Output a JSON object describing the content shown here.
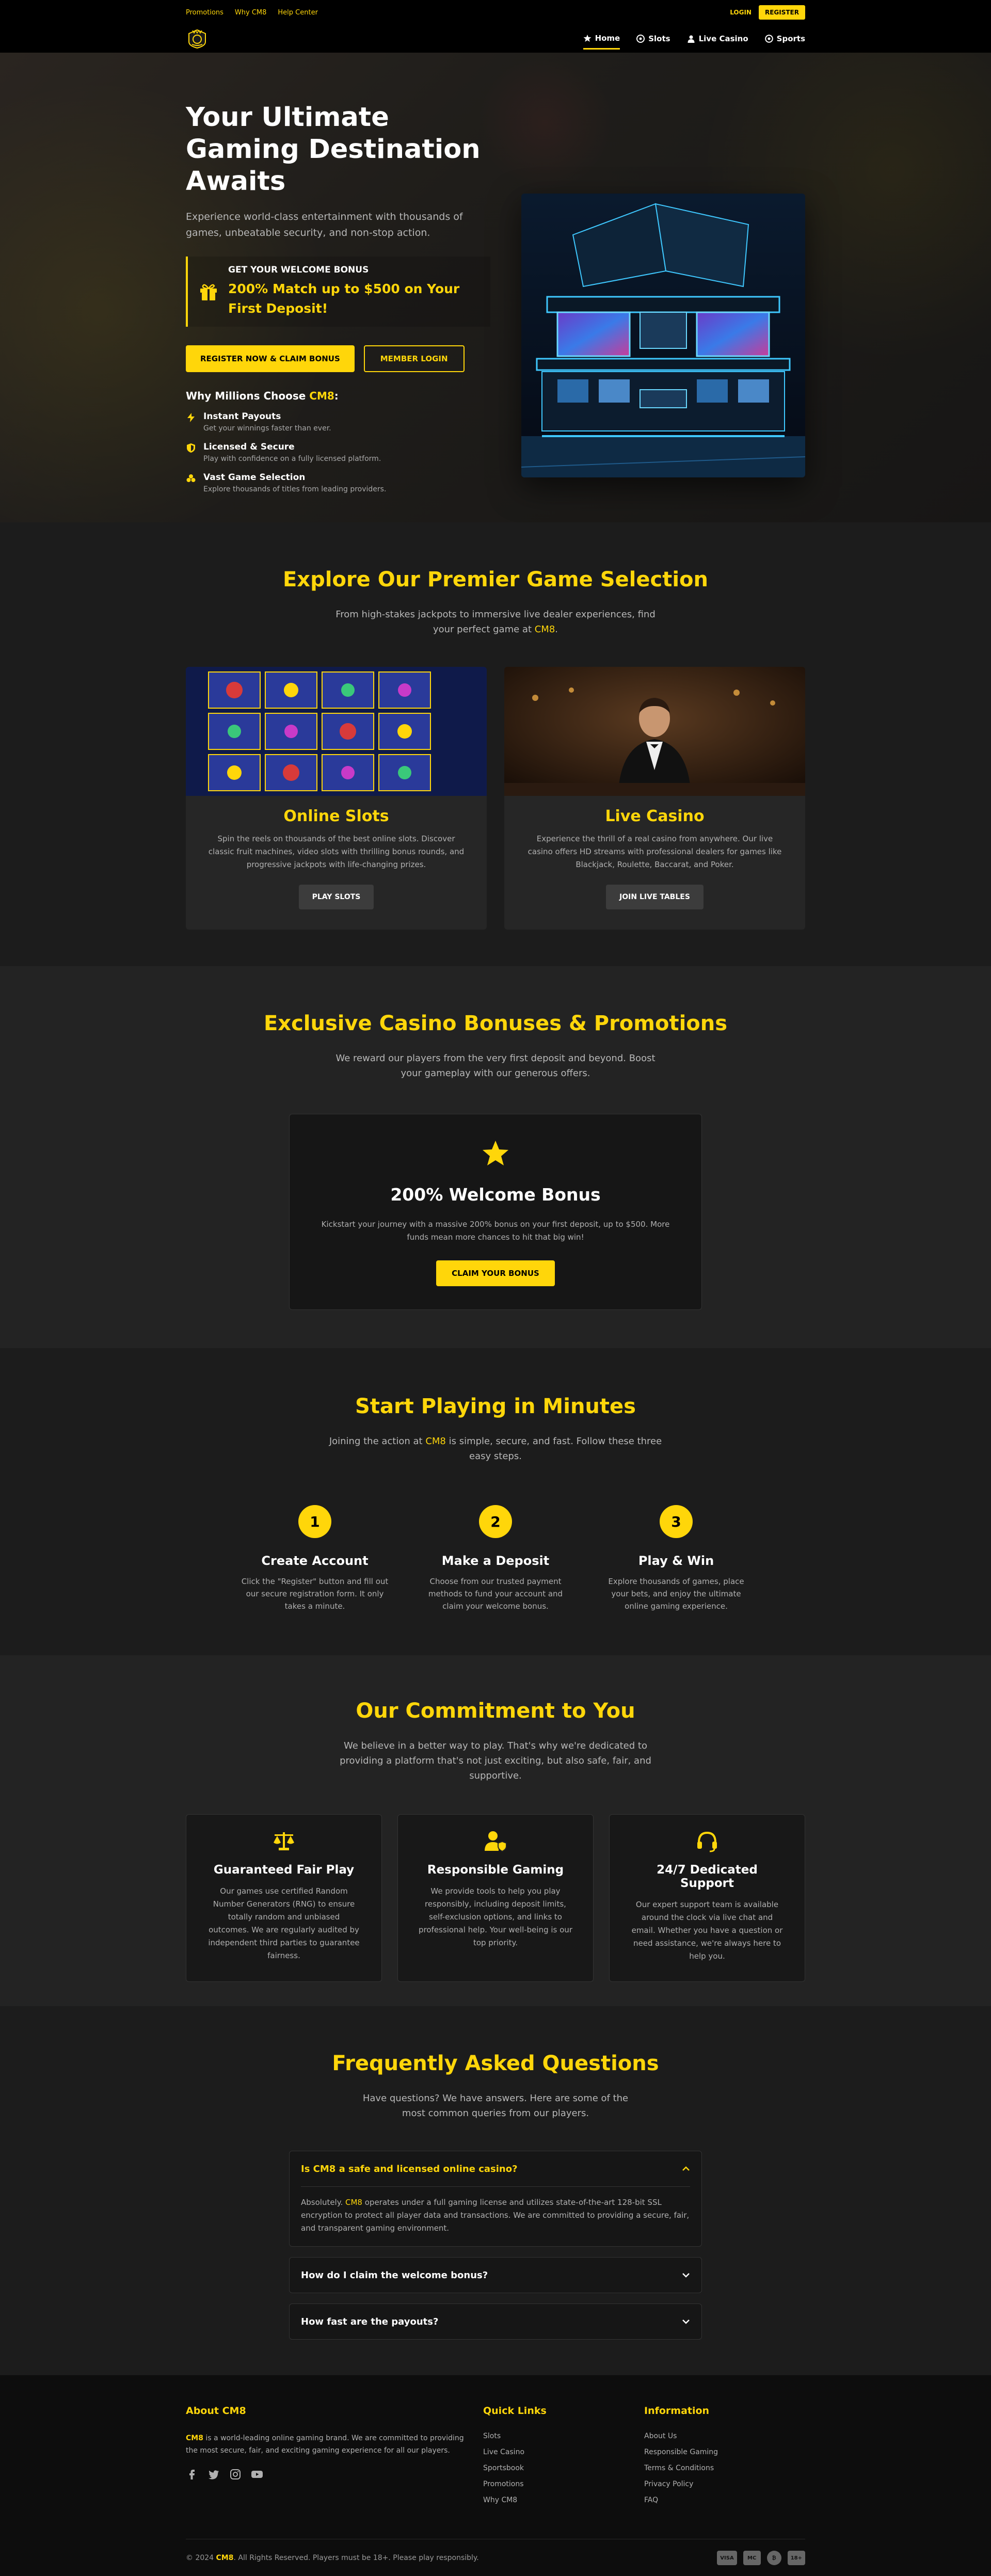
{
  "topbar": {
    "links": [
      "Promotions",
      "Why CM8",
      "Help Center"
    ],
    "login": "LOGIN",
    "register": "REGISTER"
  },
  "nav": {
    "items": [
      {
        "label": "Home",
        "icon": "star-icon",
        "active": true
      },
      {
        "label": "Slots",
        "icon": "dice-icon"
      },
      {
        "label": "Live Casino",
        "icon": "user-icon"
      },
      {
        "label": "Sports",
        "icon": "soccer-ball-icon"
      }
    ]
  },
  "hero": {
    "title": "Your Ultimate Gaming Destination Awaits",
    "subtitle": "Experience world-class entertainment with thousands of games, unbeatable security, and non-stop action.",
    "bonus_title": "GET YOUR WELCOME BONUS",
    "bonus_text": "200% Match up to $500 on Your First Deposit!",
    "primary_btn": "REGISTER NOW & CLAIM BONUS",
    "secondary_btn": "MEMBER LOGIN",
    "why_prefix": "Why Millions Choose ",
    "why_brand": "CM8",
    "why_suffix": ":",
    "features": [
      {
        "title": "Instant Payouts",
        "text": "Get your winnings faster than ever."
      },
      {
        "title": "Licensed & Secure",
        "text": "Play with confidence on a fully licensed platform."
      },
      {
        "title": "Vast Game Selection",
        "text": "Explore thousands of titles from leading providers."
      }
    ]
  },
  "games": {
    "title": "Explore Our Premier Game Selection",
    "lead_prefix": "From high-stakes jackpots to immersive live dealer experiences, find your perfect game at ",
    "lead_brand": "CM8",
    "lead_suffix": ".",
    "cards": [
      {
        "title": "Online Slots",
        "text": "Spin the reels on thousands of the best online slots. Discover classic fruit machines, video slots with thrilling bonus rounds, and progressive jackpots with life-changing prizes.",
        "button": "PLAY SLOTS"
      },
      {
        "title": "Live Casino",
        "text": "Experience the thrill of a real casino from anywhere. Our live casino offers HD streams with professional dealers for games like Blackjack, Roulette, Baccarat, and Poker.",
        "button": "JOIN LIVE TABLES"
      }
    ]
  },
  "bonus": {
    "title": "Exclusive Casino Bonuses & Promotions",
    "lead": "We reward our players from the very first deposit and beyond. Boost your gameplay with our generous offers.",
    "card_title": "200% Welcome Bonus",
    "card_text": "Kickstart your journey with a massive 200% bonus on your first deposit, up to $500. More funds mean more chances to hit that big win!",
    "card_btn": "CLAIM YOUR BONUS"
  },
  "steps": {
    "title": "Start Playing in Minutes",
    "lead_prefix": "Joining the action at ",
    "lead_brand": "CM8",
    "lead_suffix": " is simple, secure, and fast. Follow these three easy steps.",
    "items": [
      {
        "num": "1",
        "title": "Create Account",
        "text": "Click the \"Register\" button and fill out our secure registration form. It only takes a minute."
      },
      {
        "num": "2",
        "title": "Make a Deposit",
        "text": "Choose from our trusted payment methods to fund your account and claim your welcome bonus."
      },
      {
        "num": "3",
        "title": "Play & Win",
        "text": "Explore thousands of games, place your bets, and enjoy the ultimate online gaming experience."
      }
    ]
  },
  "commit": {
    "title": "Our Commitment to You",
    "lead": "We believe in a better way to play. That's why we're dedicated to providing a platform that's not just exciting, but also safe, fair, and supportive.",
    "items": [
      {
        "icon": "scale-icon",
        "title": "Guaranteed Fair Play",
        "text": "Our games use certified Random Number Generators (RNG) to ensure totally random and unbiased outcomes. We are regularly audited by independent third parties to guarantee fairness."
      },
      {
        "icon": "user-shield-icon",
        "title": "Responsible Gaming",
        "text": "We provide tools to help you play responsibly, including deposit limits, self-exclusion options, and links to professional help. Your well-being is our top priority."
      },
      {
        "icon": "headset-icon",
        "title": "24/7 Dedicated Support",
        "text": "Our expert support team is available around the clock via live chat and email. Whether you have a question or need assistance, we're always here to help you."
      }
    ]
  },
  "faq": {
    "title": "Frequently Asked Questions",
    "lead": "Have questions? We have answers. Here are some of the most common queries from our players.",
    "items": [
      {
        "q": "Is CM8 a safe and licensed online casino?",
        "a_prefix": "Absolutely. ",
        "a_brand": "CM8",
        "a_suffix": " operates under a full gaming license and utilizes state-of-the-art 128-bit SSL encryption to protect all player data and transactions. We are committed to providing a secure, fair, and transparent gaming environment.",
        "open": true
      },
      {
        "q": "How do I claim the welcome bonus?",
        "open": false
      },
      {
        "q": "How fast are the payouts?",
        "open": false
      }
    ]
  },
  "footer": {
    "about_title_prefix": "About ",
    "about_title_brand": "CM8",
    "about_brand": "CM8",
    "about_text": " is a world-leading online gaming brand. We are committed to providing the most secure, fair, and exciting gaming experience for all our players.",
    "quick_title": "Quick Links",
    "quick_links": [
      "Slots",
      "Live Casino",
      "Sportsbook",
      "Promotions",
      "Why CM8"
    ],
    "info_title": "Information",
    "info_links": [
      "About Us",
      "Responsible Gaming",
      "Terms & Conditions",
      "Privacy Policy",
      "FAQ"
    ],
    "copy_prefix": "© 2024 ",
    "copy_brand": "CM8",
    "copy_suffix": ". All Rights Reserved. Players must be 18+. Please play responsibly.",
    "payments": [
      "VISA",
      "MC",
      "₿",
      "18+"
    ]
  },
  "colors": {
    "accent": "#ffd60a",
    "background": "#171717",
    "card": "#262626"
  }
}
